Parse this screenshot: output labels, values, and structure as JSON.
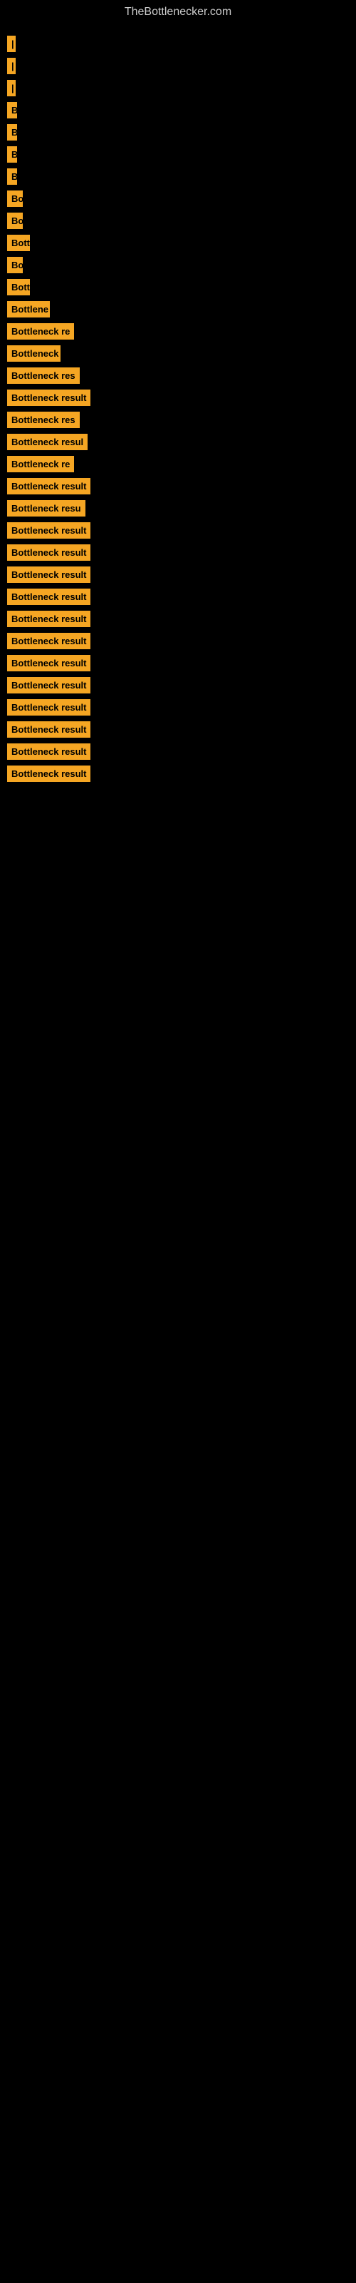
{
  "site": {
    "title": "TheBottlenecker.com"
  },
  "items": [
    {
      "label": "|",
      "width": 10
    },
    {
      "label": "|",
      "width": 10
    },
    {
      "label": "|",
      "width": 10
    },
    {
      "label": "B",
      "width": 14
    },
    {
      "label": "B",
      "width": 14
    },
    {
      "label": "B",
      "width": 14
    },
    {
      "label": "B",
      "width": 14
    },
    {
      "label": "Bo",
      "width": 22
    },
    {
      "label": "Bo",
      "width": 22
    },
    {
      "label": "Bott",
      "width": 32
    },
    {
      "label": "Bo",
      "width": 22
    },
    {
      "label": "Bott",
      "width": 32
    },
    {
      "label": "Bottlene",
      "width": 60
    },
    {
      "label": "Bottleneck re",
      "width": 100
    },
    {
      "label": "Bottleneck",
      "width": 75
    },
    {
      "label": "Bottleneck res",
      "width": 108
    },
    {
      "label": "Bottleneck result",
      "width": 130
    },
    {
      "label": "Bottleneck res",
      "width": 108
    },
    {
      "label": "Bottleneck resul",
      "width": 124
    },
    {
      "label": "Bottleneck re",
      "width": 100
    },
    {
      "label": "Bottleneck result",
      "width": 130
    },
    {
      "label": "Bottleneck resu",
      "width": 116
    },
    {
      "label": "Bottleneck result",
      "width": 130
    },
    {
      "label": "Bottleneck result",
      "width": 130
    },
    {
      "label": "Bottleneck result",
      "width": 140
    },
    {
      "label": "Bottleneck result",
      "width": 140
    },
    {
      "label": "Bottleneck result",
      "width": 150
    },
    {
      "label": "Bottleneck result",
      "width": 150
    },
    {
      "label": "Bottleneck result",
      "width": 155
    },
    {
      "label": "Bottleneck result",
      "width": 155
    },
    {
      "label": "Bottleneck result",
      "width": 160
    },
    {
      "label": "Bottleneck result",
      "width": 160
    },
    {
      "label": "Bottleneck result",
      "width": 165
    },
    {
      "label": "Bottleneck result",
      "width": 165
    }
  ]
}
